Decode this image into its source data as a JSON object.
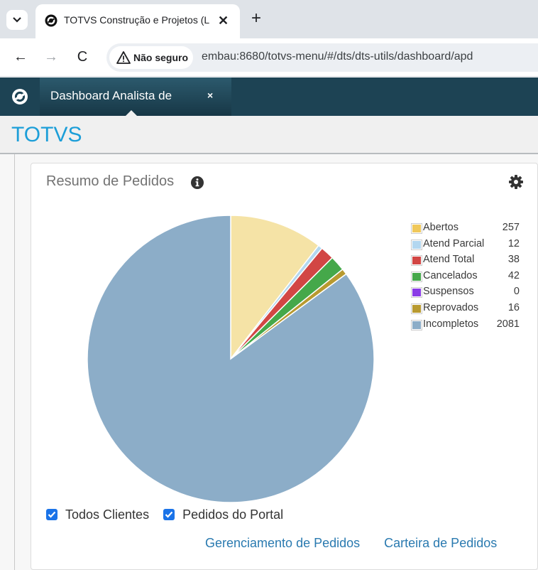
{
  "browser": {
    "tab_title": "TOTVS Construção e Projetos (L",
    "tab_close": "✕",
    "new_tab": "+",
    "security_label": "Não seguro",
    "url": "embau:8680/totvs-menu/#/dts/dts-utils/dashboard/apd",
    "back_glyph": "←",
    "forward_glyph": "→",
    "reload_glyph": "C",
    "tab_menu_icon": "chevron-down-icon"
  },
  "app": {
    "tab_title": "Dashboard Analista de",
    "tab_close": "×",
    "brand": "TOTVS"
  },
  "widget": {
    "title": "Resumo de Pedidos",
    "info_icon": "info-icon",
    "settings_icon": "gear-icon",
    "checkboxes": [
      {
        "label": "Todos Clientes",
        "checked": true
      },
      {
        "label": "Pedidos do Portal",
        "checked": true
      }
    ],
    "links": [
      {
        "label": "Gerenciamento de Pedidos"
      },
      {
        "label": "Carteira de Pedidos"
      }
    ]
  },
  "chart_data": {
    "type": "pie",
    "categories": [
      "Abertos",
      "Atend Parcial",
      "Atend Total",
      "Cancelados",
      "Suspensos",
      "Reprovados",
      "Incompletos"
    ],
    "values": [
      257,
      12,
      38,
      42,
      0,
      16,
      2081
    ],
    "colors": [
      "#f5e3a6",
      "#b3d7f0",
      "#d24644",
      "#45a84a",
      "#8a3ce6",
      "#b89a30",
      "#8cadc8"
    ],
    "legend_colors": [
      "#f0c85a",
      "#b3d7f0",
      "#d24644",
      "#45a84a",
      "#8a3ce6",
      "#b89a30",
      "#8cadc8"
    ],
    "legend_position": "top-right",
    "start_angle": "12 o'clock, clockwise"
  }
}
